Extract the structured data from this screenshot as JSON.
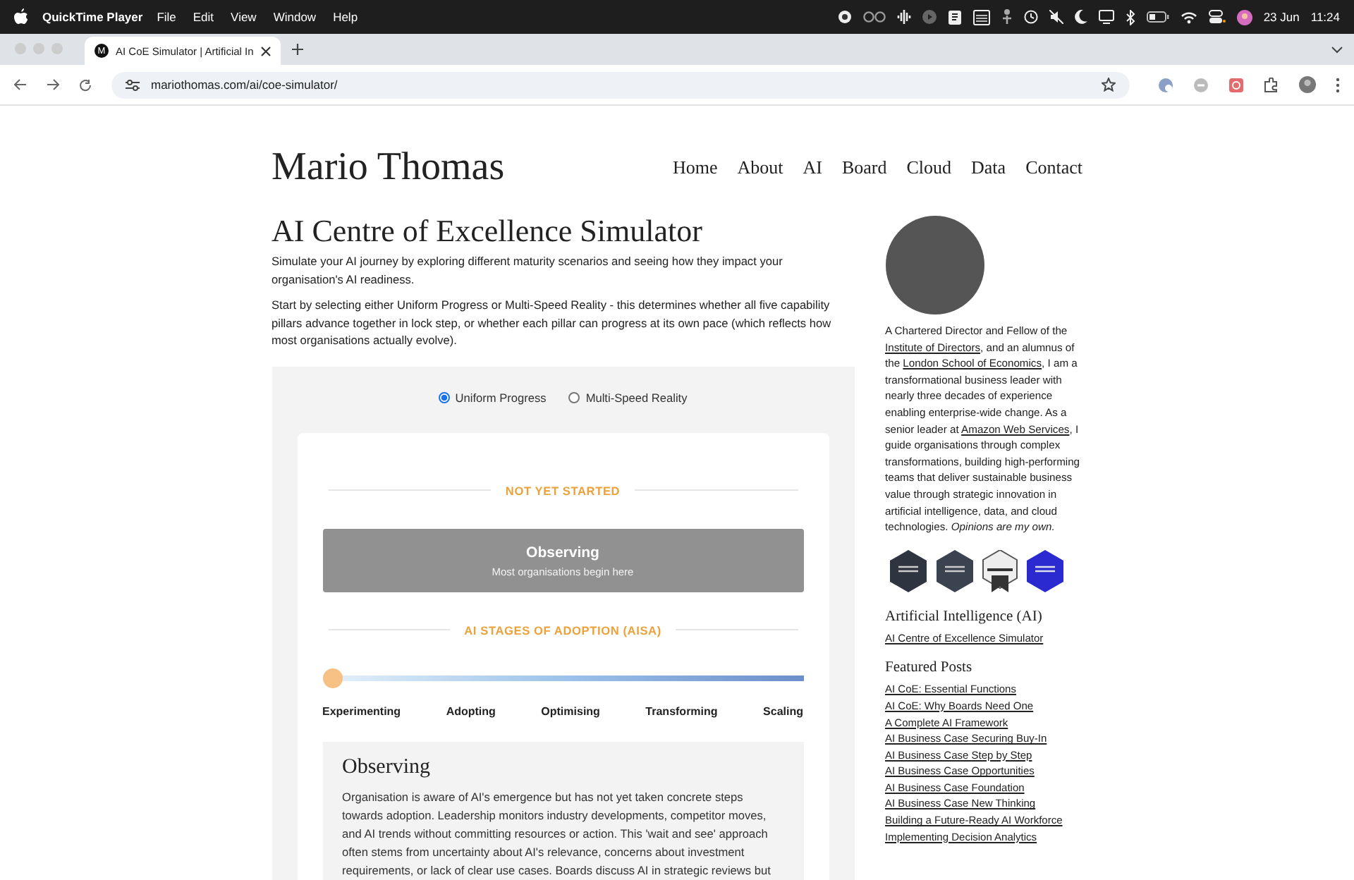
{
  "menubar": {
    "app": "QuickTime Player",
    "menus": [
      "File",
      "Edit",
      "View",
      "Window",
      "Help"
    ],
    "date": "23 Jun",
    "time": "11:24"
  },
  "browser": {
    "tab": {
      "favicon": "M",
      "title": "AI CoE Simulator | Artificial In",
      "selected": true
    },
    "url": "mariothomas.com/ai/coe-simulator/"
  },
  "site": {
    "title": "Mario Thomas",
    "nav": [
      "Home",
      "About",
      "AI",
      "Board",
      "Cloud",
      "Data",
      "Contact"
    ]
  },
  "page": {
    "title": "AI Centre of Excellence Simulator",
    "intro": [
      "Simulate your AI journey by exploring different maturity scenarios and seeing how they impact your organisation's AI readiness.",
      "Start by selecting either Uniform Progress or Multi-Speed Reality - this determines whether all five capability pillars advance together in lock step, or whether each pillar can progress at its own pace (which reflects how most organisations actually evolve)."
    ]
  },
  "simulator": {
    "modes": [
      {
        "label": "Uniform Progress",
        "selected": true
      },
      {
        "label": "Multi-Speed Reality",
        "selected": false
      }
    ],
    "status": "NOT YET STARTED",
    "stage": {
      "title": "Observing",
      "subtitle": "Most organisations begin here"
    },
    "scale_title": "AI STAGES OF ADOPTION (AISA)",
    "slider": {
      "level": 0
    },
    "stages": [
      "Experimenting",
      "Adopting",
      "Optimising",
      "Transforming",
      "Scaling"
    ],
    "detail": {
      "title": "Observing",
      "text": "Organisation is aware of AI's emergence but has not yet taken concrete steps towards adoption. Leadership monitors industry developments, competitor moves, and AI trends without committing resources or action. This 'wait and see' approach often stems from uncertainty about AI's relevance, concerns about investment requirements, or lack of clear use cases. Boards discuss AI in strategic reviews but"
    }
  },
  "sidebar": {
    "bio": [
      {
        "kind": "text",
        "text": "A Chartered Director and Fellow of the "
      },
      {
        "kind": "link",
        "text": "Institute of Directors"
      },
      {
        "kind": "text",
        "text": ", and an alumnus of the "
      },
      {
        "kind": "link",
        "text": "London School of Economics"
      },
      {
        "kind": "text",
        "text": ", I am a transformational business leader with nearly three decades of experience enabling enterprise-wide change. As a senior leader at "
      },
      {
        "kind": "link",
        "text": "Amazon Web Services"
      },
      {
        "kind": "text",
        "text": ", I guide organisations through complex transformations, building high-performing teams that deliver sustainable business value through strategic innovation in artificial intelligence, data, and cloud technologies. "
      },
      {
        "kind": "italic",
        "text": "Opinions are my own."
      }
    ],
    "sections": [
      {
        "title": "Artificial Intelligence (AI)",
        "links": [
          "AI Centre of Excellence Simulator"
        ]
      },
      {
        "title": "Featured Posts",
        "links": [
          "AI CoE: Essential Functions",
          "AI CoE: Why Boards Need One",
          "A Complete AI Framework",
          "AI Business Case Securing Buy-In",
          "AI Business Case Step by Step",
          "AI Business Case Opportunities",
          "AI Business Case Foundation",
          "AI Business Case New Thinking",
          "Building a Future-Ready AI Workforce",
          "Implementing Decision Analytics"
        ]
      }
    ]
  }
}
